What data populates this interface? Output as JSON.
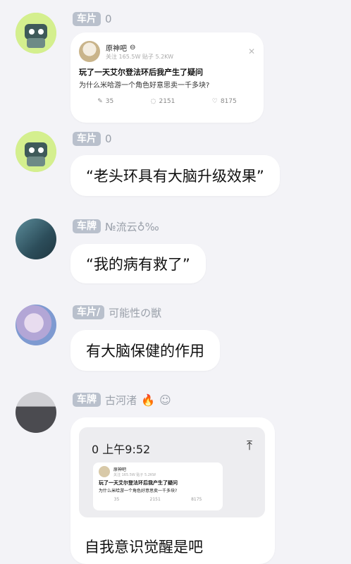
{
  "messages": [
    {
      "tag": "车片",
      "name": "0",
      "card": {
        "forum": "原神吧",
        "stats": "关注 165.5W   贴子 5.2KW",
        "title": "玩了一天艾尔登法环后我产生了疑问",
        "subtitle": "为什么米哈游一个角色好意思卖一千多块?",
        "share": "35",
        "comments": "2151",
        "likes": "8175"
      }
    },
    {
      "tag": "车片",
      "name": "0",
      "text": "“老头环具有大脑升级效果”"
    },
    {
      "tag": "车牌",
      "name": "№流云♁‰",
      "text": "“我的病有救了”"
    },
    {
      "tag": "车片/",
      "name": "可能性の獣",
      "text": "有大脑保健的作用"
    },
    {
      "tag": "车牌",
      "name": "古河渚",
      "inner": {
        "time": "0 上午9:52",
        "card": {
          "forum": "原神吧",
          "stats": "关注 165.5W   贴子 5.2KW",
          "title": "玩了一天艾尔登法环后我产生了疑问",
          "subtitle": "为什么米哈游一个角色好意思卖一千多块?",
          "share": "35",
          "comments": "2151",
          "likes": "8175"
        }
      },
      "text": "自我意识觉醒是吧"
    }
  ],
  "colors": {
    "background": "#f3f3f7",
    "bubble": "#ffffff",
    "tag": "#b9c0cc",
    "meta": "#9aa0aa"
  }
}
